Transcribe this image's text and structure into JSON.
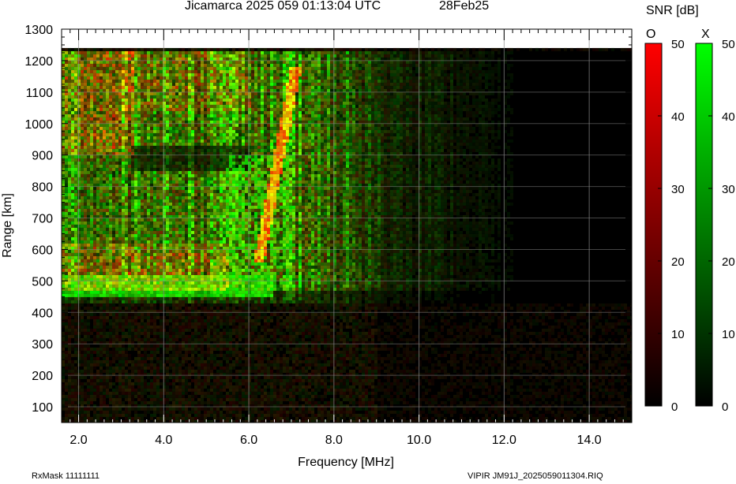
{
  "header": {
    "title": "Jicamarca 2025 059 01:13:04 UTC",
    "date": "28Feb25"
  },
  "colorbar": {
    "title": "SNR [dB]",
    "o_label": "O",
    "x_label": "X",
    "ticks": [
      "50",
      "40",
      "30",
      "20",
      "10",
      "0"
    ],
    "o_color": "#ff0000",
    "x_color": "#00ff00"
  },
  "footer": {
    "left": "RxMask 11111111",
    "right": "VIPIR  JM91J_2025059011304.RIQ"
  },
  "chart_data": {
    "type": "heatmap",
    "title": "Jicamarca 2025 059 01:13:04 UTC",
    "xlabel": "Frequency [MHz]",
    "ylabel": "Range [km]",
    "xlim": [
      1.6,
      15.0
    ],
    "ylim": [
      50,
      1300
    ],
    "data_top_km": 1240,
    "x_ticks": [
      2.0,
      4.0,
      6.0,
      8.0,
      10.0,
      12.0,
      14.0
    ],
    "x_tick_labels": [
      "2.0",
      "4.0",
      "6.0",
      "8.0",
      "10.0",
      "12.0",
      "14.0"
    ],
    "y_ticks": [
      100,
      200,
      300,
      400,
      500,
      600,
      700,
      800,
      900,
      1000,
      1100,
      1200,
      1300
    ],
    "y_tick_labels": [
      "100",
      "200",
      "300",
      "400",
      "500",
      "600",
      "700",
      "800",
      "900",
      "1000",
      "1100",
      "1200",
      "1300"
    ],
    "colorbar_range_db": [
      0,
      50
    ],
    "polarizations": [
      "O",
      "X"
    ],
    "background": "#000000",
    "grid": true
  }
}
